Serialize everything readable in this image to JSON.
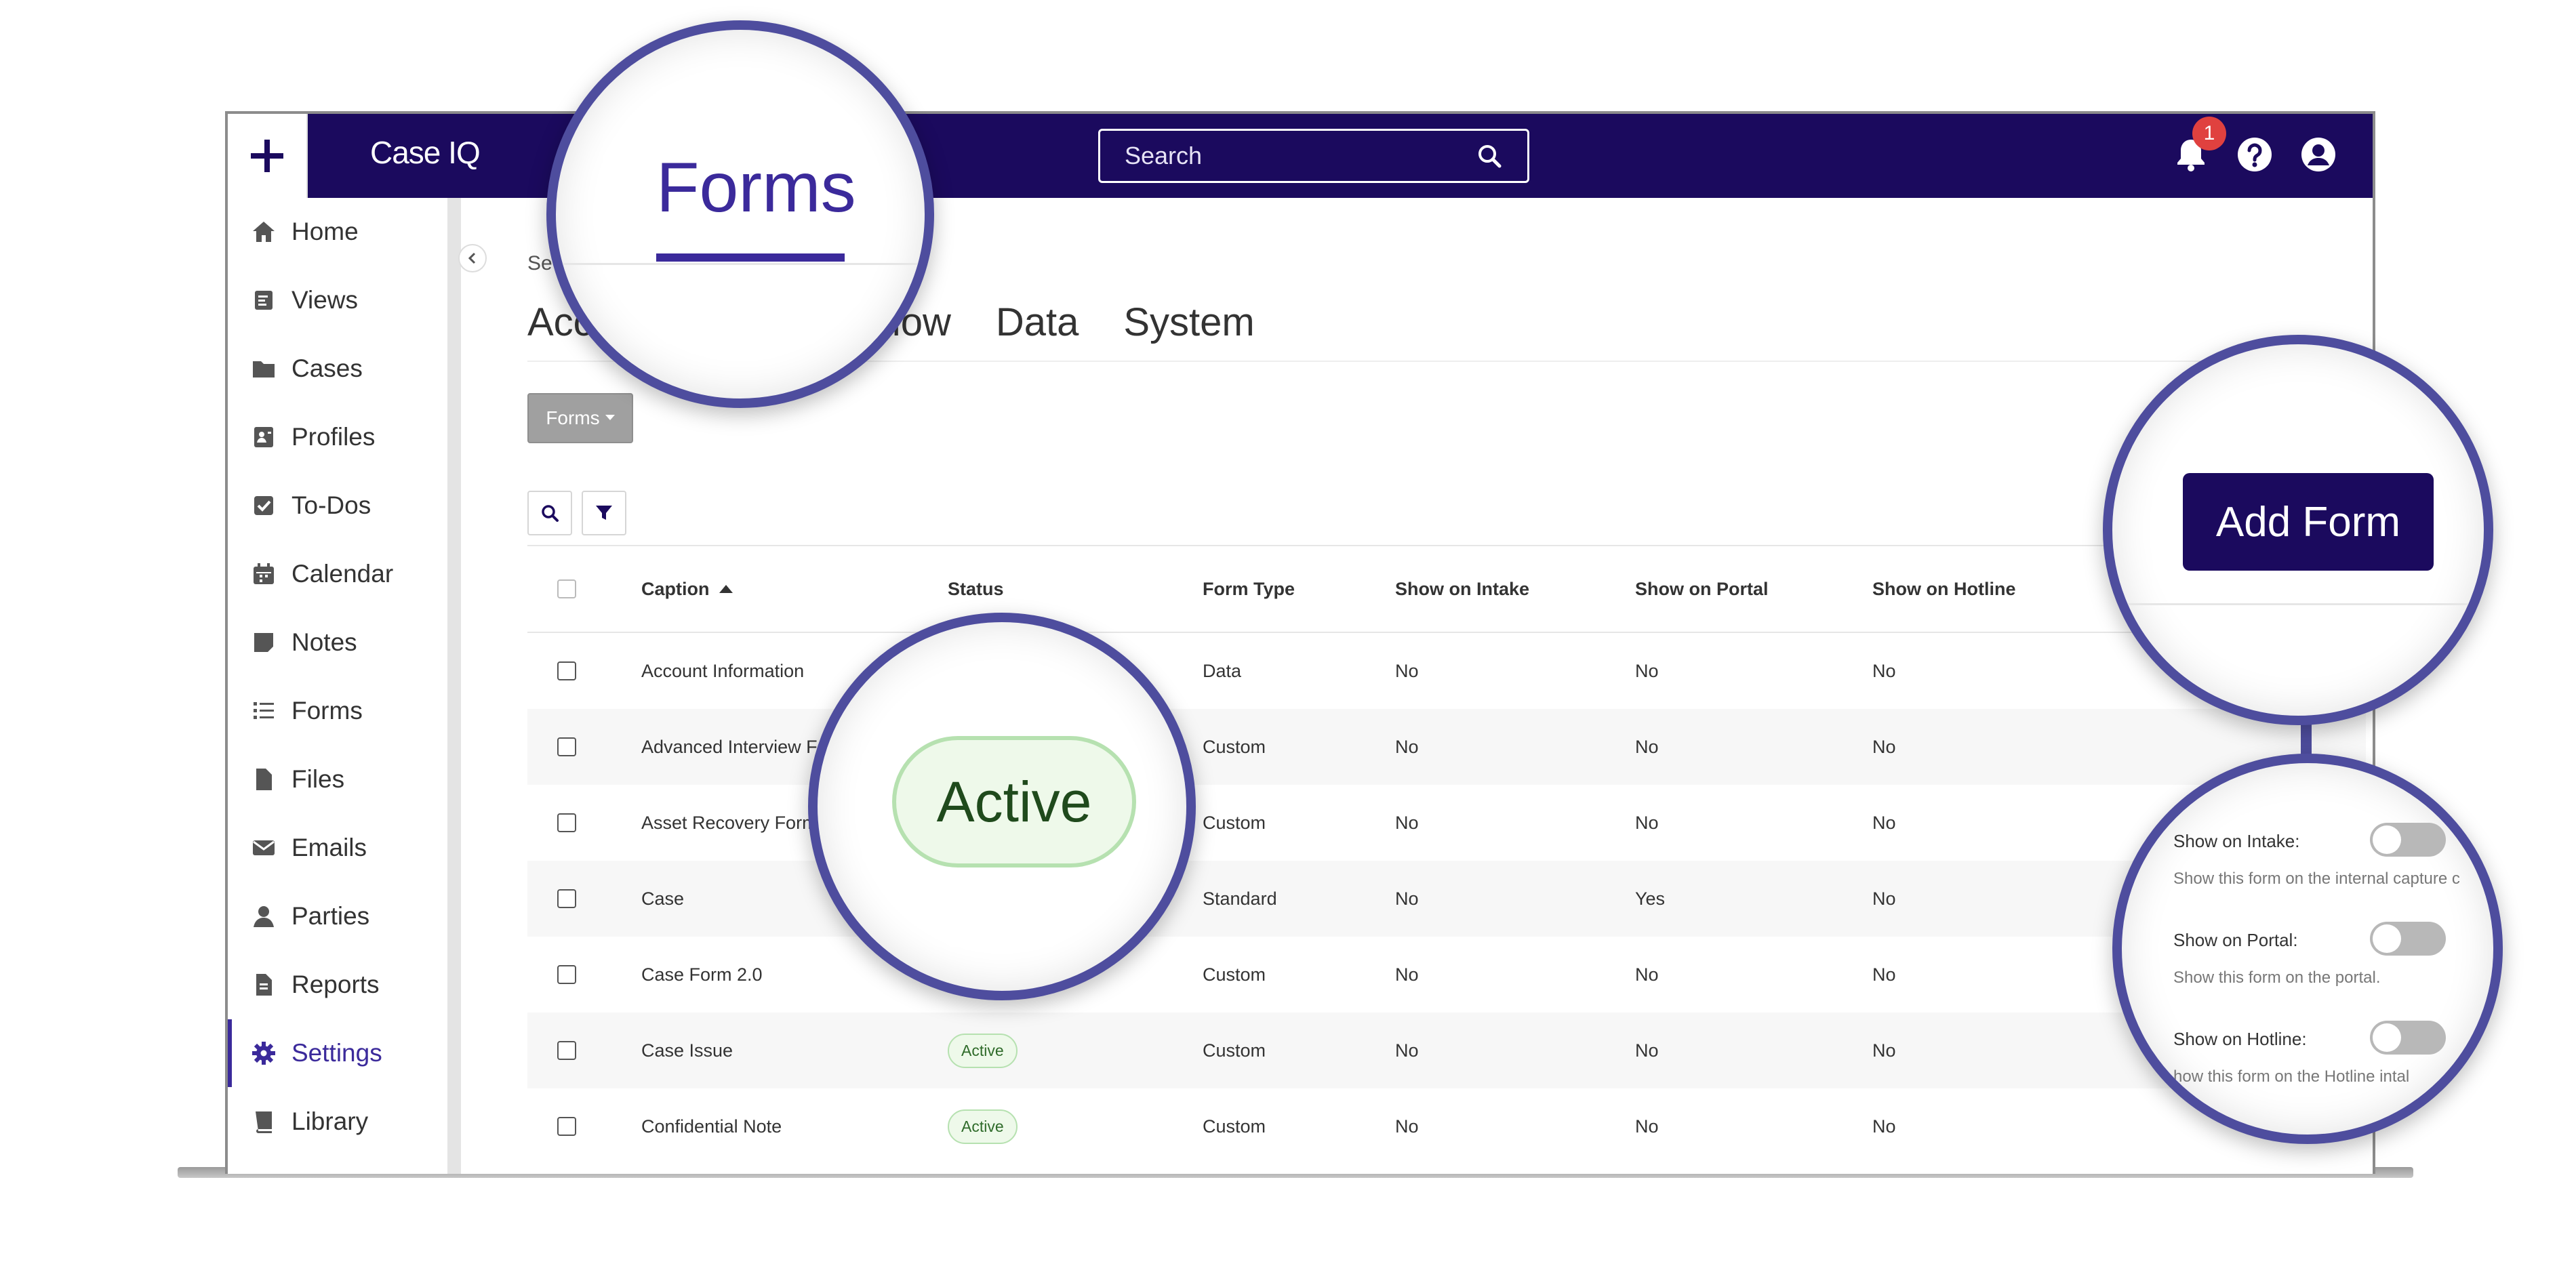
{
  "app": {
    "brand": "Case IQ"
  },
  "search": {
    "placeholder": "Search"
  },
  "notifications": {
    "count": "1"
  },
  "sidebar": {
    "items": [
      {
        "label": "Home",
        "icon": "home-icon"
      },
      {
        "label": "Views",
        "icon": "views-icon"
      },
      {
        "label": "Cases",
        "icon": "folder-icon"
      },
      {
        "label": "Profiles",
        "icon": "profile-card-icon"
      },
      {
        "label": "To-Dos",
        "icon": "checkbox-icon"
      },
      {
        "label": "Calendar",
        "icon": "calendar-icon"
      },
      {
        "label": "Notes",
        "icon": "note-icon"
      },
      {
        "label": "Forms",
        "icon": "list-icon"
      },
      {
        "label": "Files",
        "icon": "file-icon"
      },
      {
        "label": "Emails",
        "icon": "envelope-icon"
      },
      {
        "label": "Parties",
        "icon": "person-icon"
      },
      {
        "label": "Reports",
        "icon": "report-icon"
      },
      {
        "label": "Settings",
        "icon": "gear-icon"
      },
      {
        "label": "Library",
        "icon": "book-icon"
      }
    ],
    "active": "Settings"
  },
  "breadcrumb": "Se",
  "tabs": [
    {
      "label": "Acc"
    },
    {
      "label": "kflow"
    },
    {
      "label": "Data"
    },
    {
      "label": "System"
    }
  ],
  "forms_dropdown": {
    "label": "Forms"
  },
  "table": {
    "headers": {
      "caption": "Caption",
      "status": "Status",
      "form_type": "Form Type",
      "show_on_intake": "Show on Intake",
      "show_on_portal": "Show on Portal",
      "show_on_hotline": "Show on Hotline"
    },
    "rows": [
      {
        "caption": "Account Information",
        "status": "",
        "form_type": "Data",
        "intake": "No",
        "portal": "No",
        "hotline": "No"
      },
      {
        "caption": "Advanced Interview Fo",
        "status": "",
        "form_type": "Custom",
        "intake": "No",
        "portal": "No",
        "hotline": "No"
      },
      {
        "caption": "Asset Recovery Form",
        "status": "",
        "form_type": "Custom",
        "intake": "No",
        "portal": "No",
        "hotline": "No"
      },
      {
        "caption": "Case",
        "status": "",
        "form_type": "Standard",
        "intake": "No",
        "portal": "Yes",
        "hotline": "No"
      },
      {
        "caption": "Case Form 2.0",
        "status": "",
        "form_type": "Custom",
        "intake": "No",
        "portal": "No",
        "hotline": "No"
      },
      {
        "caption": "Case Issue",
        "status": "Active",
        "form_type": "Custom",
        "intake": "No",
        "portal": "No",
        "hotline": "No"
      },
      {
        "caption": "Confidential Note",
        "status": "Active",
        "form_type": "Custom",
        "intake": "No",
        "portal": "No",
        "hotline": "No"
      }
    ]
  },
  "callouts": {
    "forms_tab": "Forms",
    "status_pill": "Active",
    "add_form": "Add Form",
    "options": [
      {
        "label": "Show on Intake:",
        "description": "Show this form on the internal capture c"
      },
      {
        "label": "Show on Portal:",
        "description": "Show this form on the portal."
      },
      {
        "label": "Show on Hotline:",
        "description": "how this form on the Hotline intal"
      }
    ]
  },
  "colors": {
    "primary": "#1b0a5e",
    "accent": "#3b2a9b",
    "lens": "#4e4d9e",
    "active_green": "#eef9ea",
    "badge": "#e0413f"
  }
}
